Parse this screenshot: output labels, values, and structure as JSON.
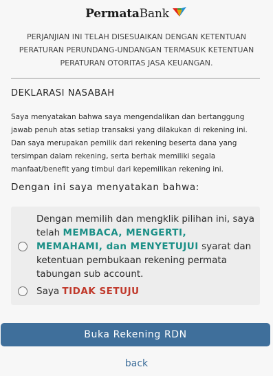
{
  "brand": {
    "name_bold": "Permata",
    "name_regular": "Bank"
  },
  "regulation_notice": "PERJANJIAN INI TELAH DISESUAIKAN DENGAN KETENTUAN PERATURAN PERUNDANG-UNDANGAN TERMASUK KETENTUAN PERATURAN OTORITAS JASA KEUANGAN.",
  "declaration": {
    "title": "DEKLARASI NASABAH",
    "body": "Saya menyatakan bahwa saya mengendalikan dan bertanggung jawab penuh atas setiap transaksi yang dilakukan di rekening ini. Dan saya merupakan pemilik dari rekening beserta dana yang tersimpan dalam rekening, serta berhak memiliki segala manfaat/benefit yang timbul dari kepemilikan rekening ini."
  },
  "statement_heading": "Dengan ini saya menyatakan bahwa:",
  "options": {
    "agree": {
      "prefix": "Dengan memilih dan mengklik pilihan ini, saya telah ",
      "emphasis": "MEMBACA, MENGERTI, MEMAHAMI, dan MENYETUJUI",
      "suffix": " syarat dan ketentuan pembukaan rekening permata tabungan sub account."
    },
    "disagree": {
      "prefix": "Saya ",
      "emphasis": "TIDAK SETUJU"
    }
  },
  "actions": {
    "primary_label": "Buka Rekening RDN",
    "back_label": "back"
  },
  "colors": {
    "primary": "#3f6f9b",
    "agree_emphasis": "#1a8f86",
    "disagree_emphasis": "#c0392b"
  }
}
